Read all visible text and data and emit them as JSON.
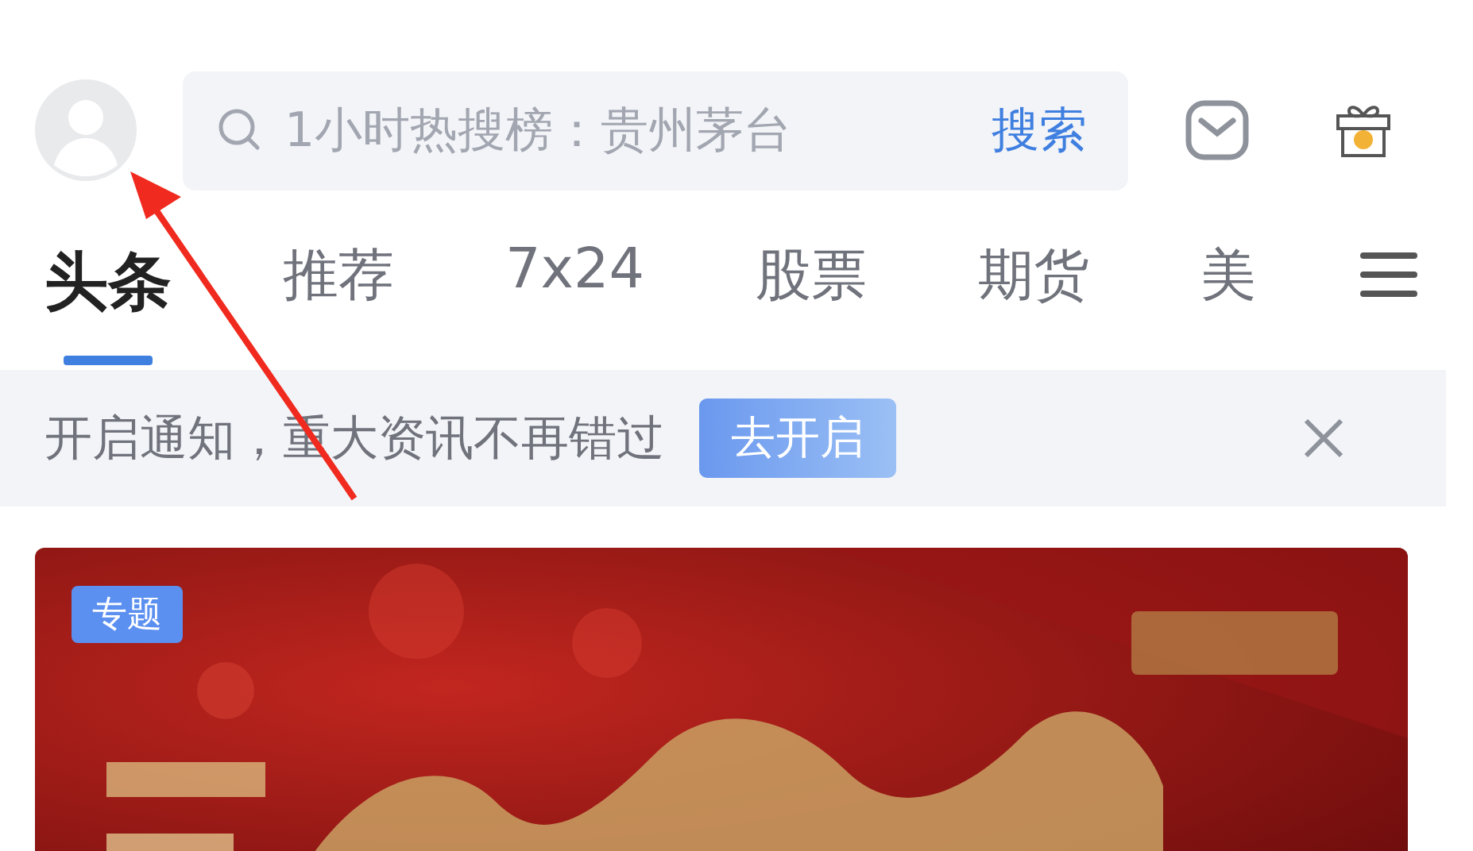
{
  "search": {
    "placeholder": "1小时热搜榜：贵州茅台",
    "button": "搜索"
  },
  "tabs": [
    {
      "label": "头条",
      "selected": true
    },
    {
      "label": "推荐",
      "selected": false
    },
    {
      "label": "7x24",
      "selected": false
    },
    {
      "label": "股票",
      "selected": false
    },
    {
      "label": "期货",
      "selected": false
    },
    {
      "label": "美",
      "selected": false
    }
  ],
  "notice": {
    "text": "开启通知，重大资讯不再错过",
    "button": "去开启"
  },
  "banner": {
    "kind": "picture",
    "tag": "专题"
  }
}
